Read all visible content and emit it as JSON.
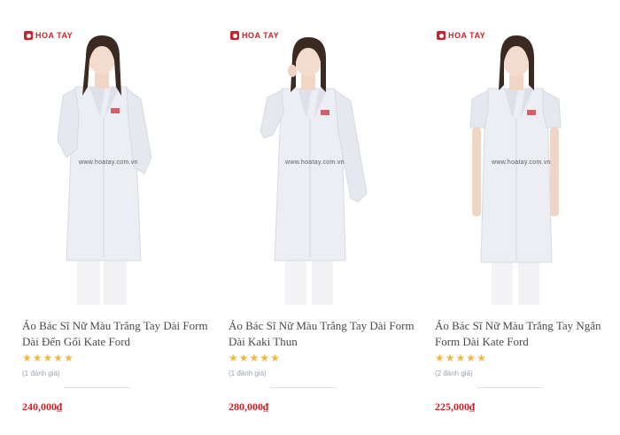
{
  "brand": {
    "logo_text": "HOA TAY",
    "watermark": "www.hoatay.com.vn",
    "colors": {
      "brand_red": "#c8242a",
      "price_red": "#c71f25",
      "star_gold": "#f0b840",
      "muted_text": "#9aa4b0"
    }
  },
  "products": [
    {
      "title": "Áo Bác Sĩ Nữ Màu Trắng Tay Dài Form Dài Đến Gối Kate Ford",
      "rating": 5,
      "reviews": "(1 đánh giá)",
      "price": "240,000₫"
    },
    {
      "title": "Áo Bác Sĩ Nữ Màu Trắng Tay Dài Form Dài Kaki Thun",
      "rating": 5,
      "reviews": "(1 đánh giá)",
      "price": "280,000₫"
    },
    {
      "title": "Áo Bác Sĩ Nữ Màu Trắng Tay Ngắn Form Dài Kate Ford",
      "rating": 5,
      "reviews": "(2 đánh giá)",
      "price": "225,000₫"
    }
  ],
  "icons": {
    "star": "star-icon",
    "logo": "hoa-tay-logo-icon"
  }
}
